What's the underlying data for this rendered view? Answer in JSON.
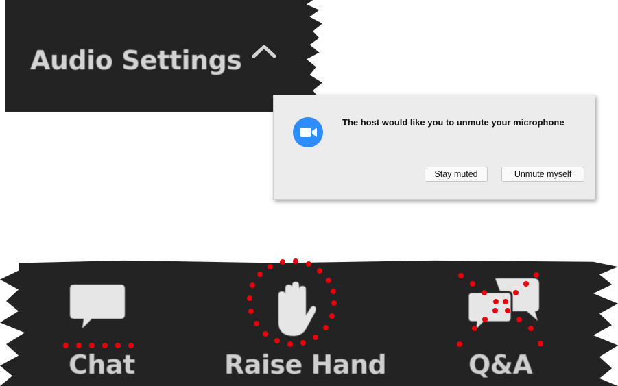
{
  "audio_panel": {
    "label": "Audio Settings",
    "caret_icon": "chevron-up-icon"
  },
  "dialog": {
    "icon": "zoom-camera-icon",
    "message": "The host would like you to unmute your microphone",
    "buttons": {
      "stay_muted": "Stay muted",
      "unmute_myself": "Unmute myself"
    }
  },
  "toolbar": {
    "chat": {
      "label": "Chat",
      "icon": "chat-bubble-icon"
    },
    "raise_hand": {
      "label": "Raise Hand",
      "icon": "hand-icon"
    },
    "qa": {
      "label": "Q&A",
      "icon": "qa-bubbles-icon"
    }
  },
  "annotations": {
    "color": "#e8000c",
    "chat": "dotted-underline",
    "raise_hand": "dotted-circle",
    "qa": "dotted-cross"
  },
  "colors": {
    "dark_bar": "#232323",
    "dialog_bg": "#ececec",
    "zoom_blue": "#2d8cff",
    "label_gray": "#d0d0d0"
  }
}
